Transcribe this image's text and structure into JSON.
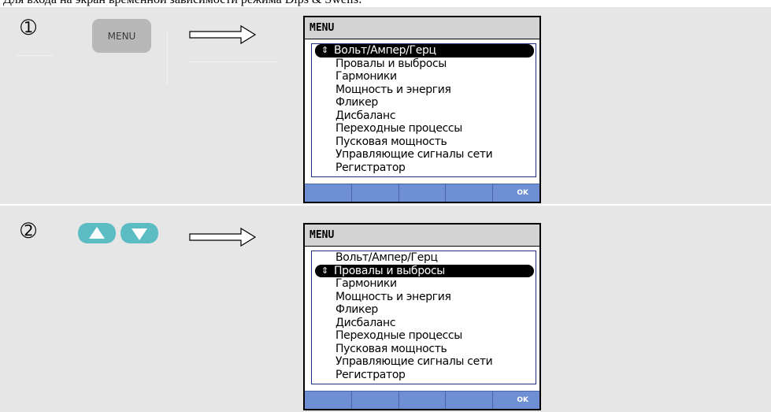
{
  "intro_text": "Для входа на экран временной зависимости режима Dips & Swells:",
  "steps": [
    {
      "number": "➀",
      "key_label": "MENU",
      "screen": {
        "title": "MENU",
        "items": [
          "Вольт/Ампер/Герц",
          "Провалы и выбросы",
          "Гармоники",
          "Мощность и энергия",
          "Фликер",
          "Дисбаланс",
          "Переходные процессы",
          "Пусковая мощность",
          "Управляющие сигналы сети",
          "Регистратор"
        ],
        "selected_index": 0,
        "softkeys": [
          "",
          "",
          "",
          "",
          "OK"
        ]
      }
    },
    {
      "number": "➁",
      "keys": [
        "arrow-up-key",
        "arrow-down-key"
      ],
      "screen": {
        "title": "MENU",
        "items": [
          "Вольт/Ампер/Герц",
          "Провалы и выбросы",
          "Гармоники",
          "Мощность и энергия",
          "Фликер",
          "Дисбаланс",
          "Переходные процессы",
          "Пусковая мощность",
          "Управляющие сигналы сети",
          "Регистратор"
        ],
        "selected_index": 1,
        "softkeys": [
          "",
          "",
          "",
          "",
          "OK"
        ]
      }
    }
  ],
  "selection_marker": "⇕",
  "colors": {
    "row_bg": "#e6e6e6",
    "screen_title_bg": "#d3d3d3",
    "softkey_bar": "#6e8fd4",
    "nav_key": "#5bbcc4",
    "menu_key": "#b8b8b8"
  }
}
